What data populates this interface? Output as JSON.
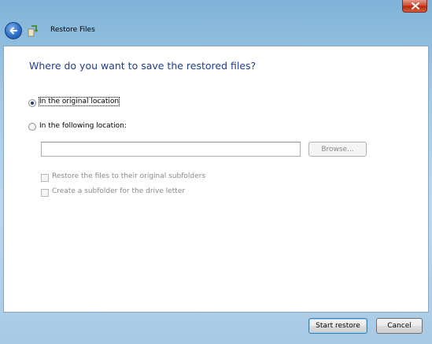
{
  "window": {
    "title": "Restore Files"
  },
  "heading": "Where do you want to save the restored files?",
  "options": {
    "original": {
      "label": "In the original location",
      "selected": true
    },
    "following": {
      "label": "In the following location:",
      "selected": false
    }
  },
  "location_input": {
    "value": ""
  },
  "browse_label": "Browse...",
  "checkboxes": {
    "subfolders": {
      "label": "Restore the files to their original subfolders",
      "checked": false,
      "enabled": false
    },
    "drive_letter": {
      "label": "Create a subfolder for the drive letter",
      "checked": false,
      "enabled": false
    }
  },
  "footer": {
    "start_label": "Start restore",
    "cancel_label": "Cancel"
  },
  "colors": {
    "heading": "#1e3f8a",
    "window_frame": "#a6cbe6",
    "close_button": "#cf4a30"
  },
  "icons": [
    "close-icon",
    "back-arrow-icon",
    "restore-files-icon"
  ]
}
